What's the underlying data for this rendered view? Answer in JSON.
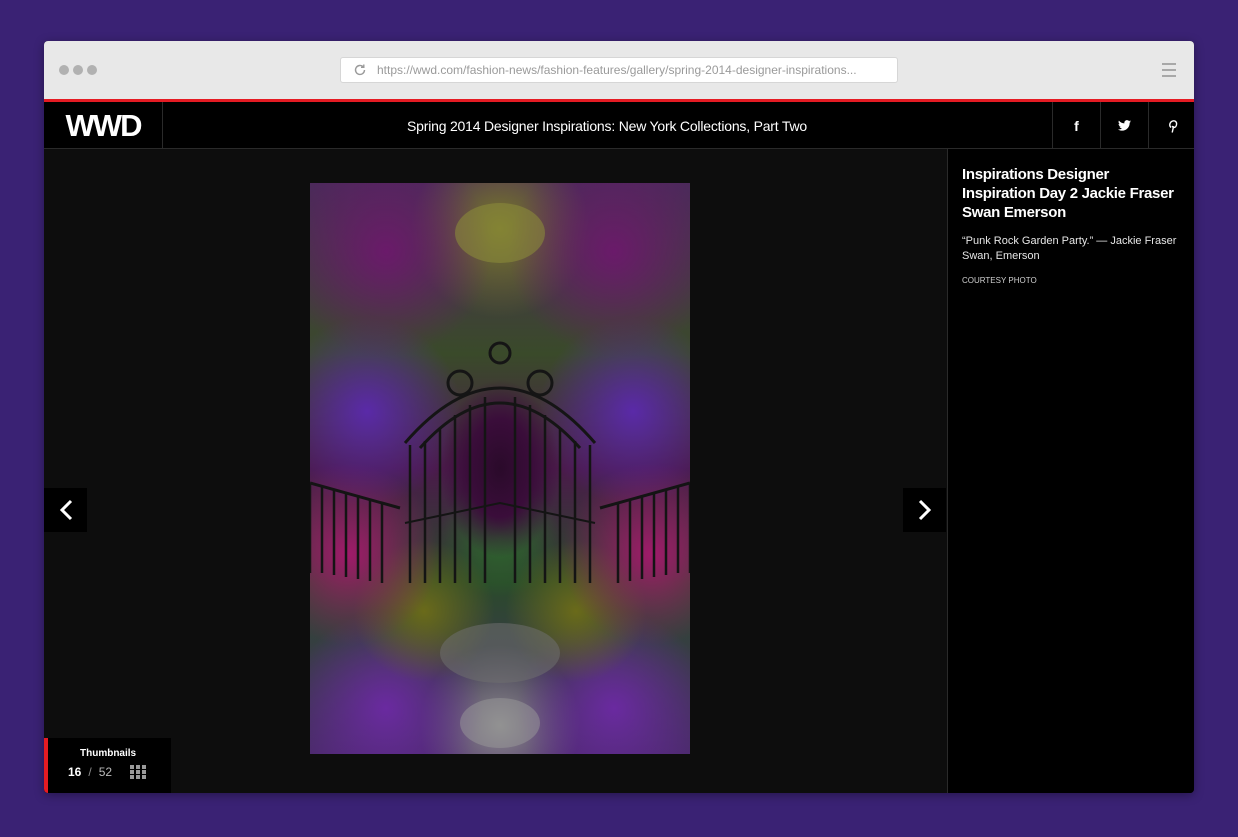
{
  "browser": {
    "url": "https://wwd.com/fashion-news/fashion-features/gallery/spring-2014-designer-inspirations..."
  },
  "header": {
    "logo": "WWD",
    "title": "Spring 2014 Designer Inspirations: New York Collections, Part Two",
    "social": {
      "facebook": "f",
      "twitter": "twitter-icon",
      "pinterest": "pinterest-icon"
    }
  },
  "gallery": {
    "thumbnails_label": "Thumbnails",
    "current": "16",
    "separator": "/",
    "total": "52"
  },
  "slide": {
    "title": "Inspirations Designer Inspiration Day 2 Jackie Fraser Swan Emerson",
    "caption": "“Punk Rock Garden Party.” — Jackie Fraser Swan, Emerson",
    "credit": "COURTESY PHOTO"
  },
  "colors": {
    "page_background": "#3a2274",
    "accent": "#e51b23",
    "header": "#000000",
    "stage": "#0d0d0d"
  }
}
